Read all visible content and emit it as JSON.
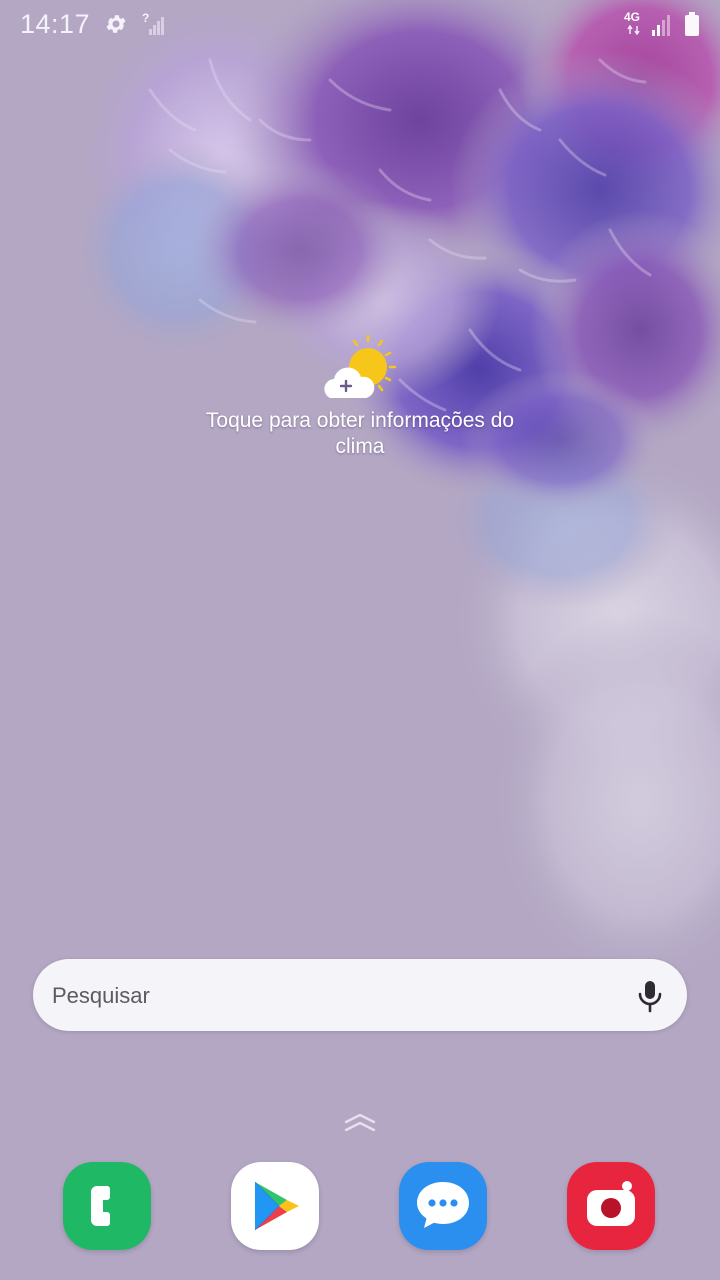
{
  "status_bar": {
    "time": "14:17",
    "network_type": "4G",
    "icons": [
      "gear-icon",
      "no-signal-icon",
      "network-4g-icon",
      "cell-signal-icon",
      "battery-icon"
    ]
  },
  "weather": {
    "icon": "weather-add-icon",
    "message": "Toque para obter informações do clima"
  },
  "search": {
    "placeholder": "Pesquisar",
    "mic_icon": "microphone-icon"
  },
  "drawer": {
    "icon": "chevron-up-icon"
  },
  "dock": {
    "apps": [
      {
        "name": "phone",
        "icon": "phone-icon",
        "color": "#1fb865"
      },
      {
        "name": "play-store",
        "icon": "play-store-icon",
        "color": "#ffffff"
      },
      {
        "name": "messages",
        "icon": "messages-icon",
        "color": "#2b8ff0"
      },
      {
        "name": "camera",
        "icon": "camera-icon",
        "color": "#e8253f"
      }
    ]
  },
  "colors": {
    "wallpaper_base": "#b3a7c3",
    "flower_purple": "#7a4fa8",
    "flower_violet": "#5b45b8",
    "flower_lilac": "#c3a6d8",
    "sun_yellow": "#f7c61a"
  }
}
